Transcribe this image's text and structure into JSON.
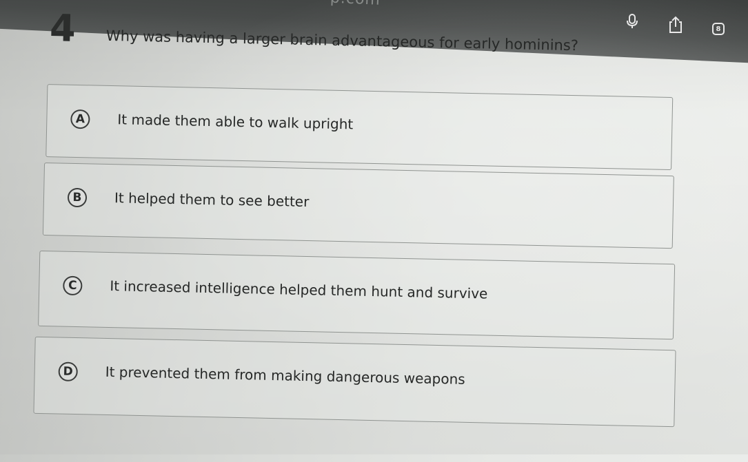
{
  "browser": {
    "url_fragment": "-p.com",
    "tab_count": "8",
    "icons": [
      "mic-icon",
      "share-icon",
      "tabs-icon"
    ]
  },
  "question": {
    "number": "4",
    "text": "Why was having a larger brain advantageous for early hominins?"
  },
  "options": [
    {
      "letter": "A",
      "text": "It made them able to walk upright"
    },
    {
      "letter": "B",
      "text": "It helped them to see better"
    },
    {
      "letter": "C",
      "text": "It increased intelligence helped them hunt and survive"
    },
    {
      "letter": "D",
      "text": "It prevented them from making dangerous weapons"
    }
  ],
  "colors": {
    "top_bar": "#4c4f4e",
    "background": "#e0e2df",
    "text": "#262827",
    "border": "#8f9390"
  }
}
